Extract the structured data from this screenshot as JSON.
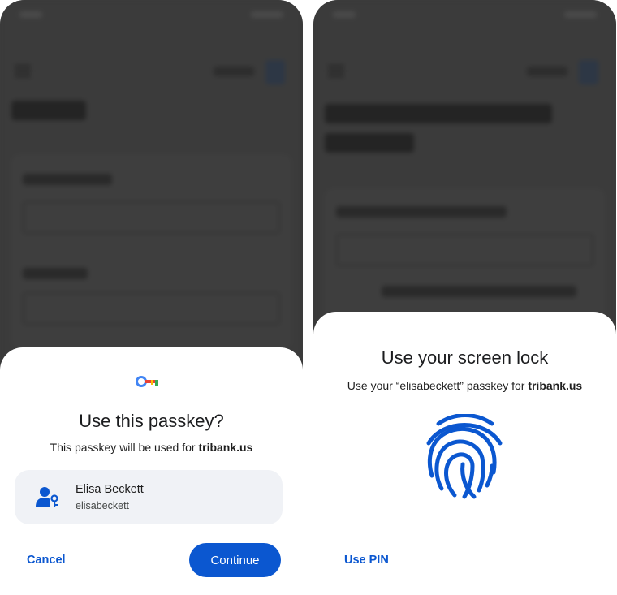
{
  "left_screen": {
    "sheet": {
      "icon": "passkey-key-icon",
      "title": "Use this passkey?",
      "subtitle_prefix": "This passkey will be used for ",
      "subtitle_domain": "tribank.us",
      "account": {
        "icon": "person-key-icon",
        "name": "Elisa Beckett",
        "username": "elisabeckett"
      },
      "cancel_label": "Cancel",
      "continue_label": "Continue"
    }
  },
  "right_screen": {
    "sheet": {
      "title": "Use your screen lock",
      "subtitle_prefix": "Use your “elisabeckett” passkey for ",
      "subtitle_domain": "tribank.us",
      "icon": "fingerprint-icon",
      "use_pin_label": "Use PIN"
    }
  },
  "colors": {
    "accent": "#0b57d0",
    "scrim": "#3b3b3b",
    "card": "#f0f2f6"
  }
}
